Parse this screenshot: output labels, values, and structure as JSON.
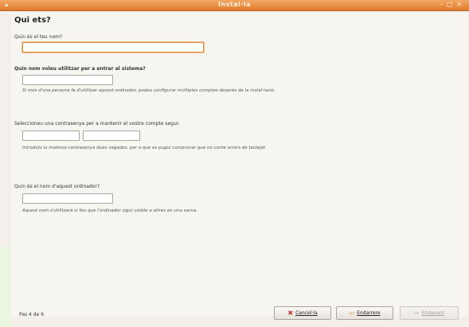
{
  "window": {
    "title": "Instal·la",
    "controls": "– □ ✕",
    "menu_glyph": "▴"
  },
  "page": {
    "heading": "Qui ets?"
  },
  "fields": {
    "full_name": {
      "label": "Quin és el teu nom?",
      "value": ""
    },
    "login": {
      "label": "Quin nom voleu utilitzar per a entrar al sistema?",
      "value": "",
      "hint": "Si més d'una persona fa d'utilitzar aquest ordinador, podeu configurar múltiples comptes després de la instal·lació."
    },
    "password": {
      "label": "Seleccioneu una contrasenya per a mantenir el vostre compte segur.",
      "value": "",
      "confirm_value": "",
      "hint": "Introduïu la mateixa contrasenya dues vegades, per a que es pugui comprovar que no conté errors de teclejat."
    },
    "hostname": {
      "label": "Quin és el nom d'aquest ordinador?",
      "value": "",
      "hint": "Aquest nom s'utilitzarà si feu que l'ordinador sigui visible a altres en una xarxa."
    }
  },
  "footer": {
    "step": "Pas 4 de 6",
    "cancel_label": "Cancel·la",
    "back_label": "Endarrere",
    "forward_label": "Endavant"
  },
  "colors": {
    "accent": "#e07c2b",
    "titlebar": "#f2a765",
    "background": "#f3f0e9"
  }
}
